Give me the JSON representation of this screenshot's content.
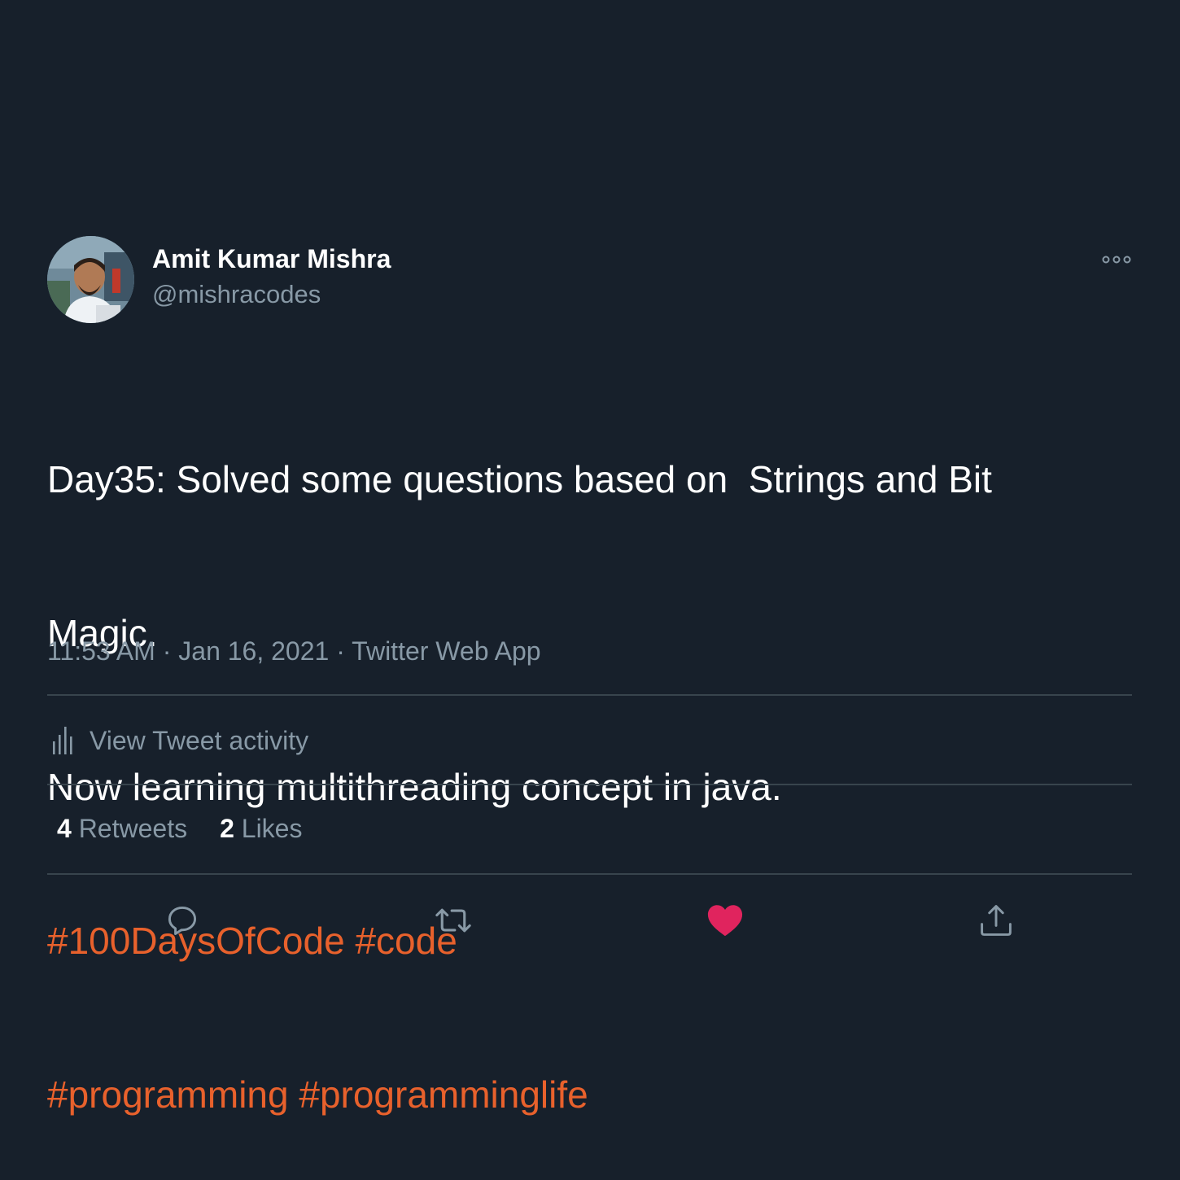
{
  "author": {
    "display_name": "Amit Kumar Mishra",
    "handle": "@mishracodes"
  },
  "tweet": {
    "lines": [
      "Day35: Solved some questions based on  Strings and Bit",
      "Magic.",
      "Now learning multithreading concept in java."
    ],
    "hashtags": [
      "#100DaysOfCode",
      "#code",
      "#programming",
      "#programminglife"
    ]
  },
  "meta": {
    "time": "11:53 AM",
    "separator1": " · ",
    "date": "Jan 16, 2021",
    "separator2": " · ",
    "source": "Twitter Web App"
  },
  "activity": {
    "label": "View Tweet activity"
  },
  "stats": {
    "retweets_count": "4",
    "retweets_label": "Retweets",
    "likes_count": "2",
    "likes_label": "Likes"
  },
  "colors": {
    "background": "#17202b",
    "hashtag": "#e8612c",
    "muted": "#8899a6",
    "divider": "#38444d",
    "like_active": "#e0245e"
  },
  "icons": {
    "more": "more-icon",
    "activity": "bar-chart-icon",
    "reply": "reply-icon",
    "retweet": "retweet-icon",
    "like": "heart-icon",
    "share": "share-icon"
  }
}
